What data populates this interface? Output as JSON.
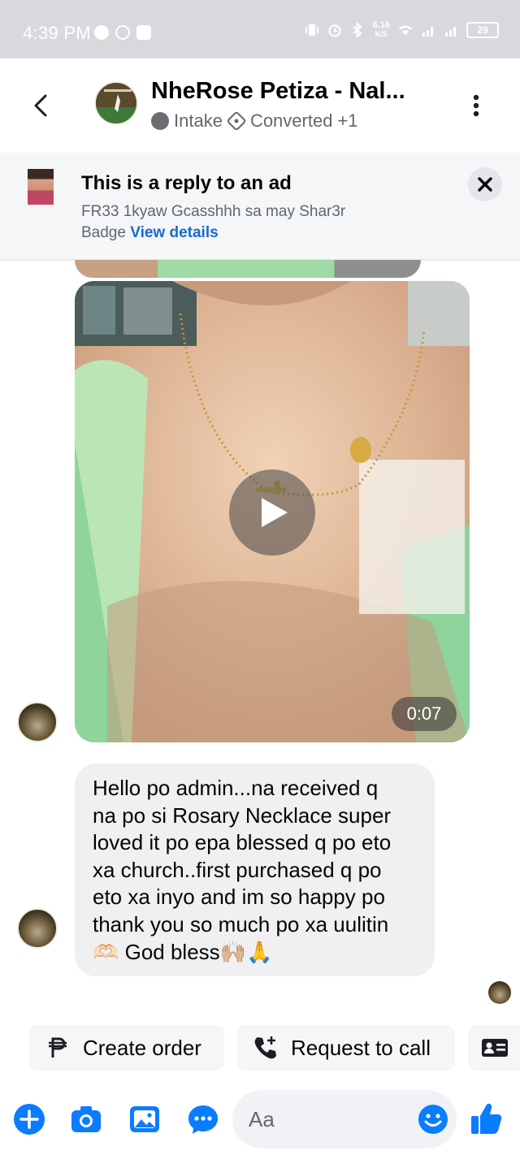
{
  "status_bar": {
    "time": "4:39 PM",
    "network_speed": "6.16",
    "network_speed_unit": "K/S",
    "battery": "29"
  },
  "header": {
    "name": "NheRose Petiza - Nal...",
    "stage": "Intake",
    "label": "Converted",
    "extra_count": "+1"
  },
  "ad_banner": {
    "title": "This is a reply to an ad",
    "description": "FR33 1kyaw Gcasshhh sa may Shar3r Badge",
    "link": "View details"
  },
  "video": {
    "duration": "0:07"
  },
  "message": {
    "text": "Hello po admin...na received q\nna po si Rosary Necklace super\nloved it po epa blessed q po eto\nxa church..first purchased q po\neto xa inyo and im so happy po\nthank you so much po xa uulitin\n🫶🏻 God bless🙌🏼🙏"
  },
  "quick_actions": {
    "create_order": "Create order",
    "request_call": "Request to call"
  },
  "composer": {
    "placeholder": "Aa"
  },
  "colors": {
    "brand_blue": "#0a7cff",
    "link_blue": "#1769d2",
    "bubble_grey": "#f0f0f2"
  },
  "icons": [
    "back-chevron-icon",
    "more-vertical-icon",
    "close-icon",
    "play-icon",
    "peso-icon",
    "phone-plus-icon",
    "contact-card-icon",
    "plus-icon",
    "camera-icon",
    "image-icon",
    "chat-more-icon",
    "emoji-icon",
    "like-icon"
  ]
}
